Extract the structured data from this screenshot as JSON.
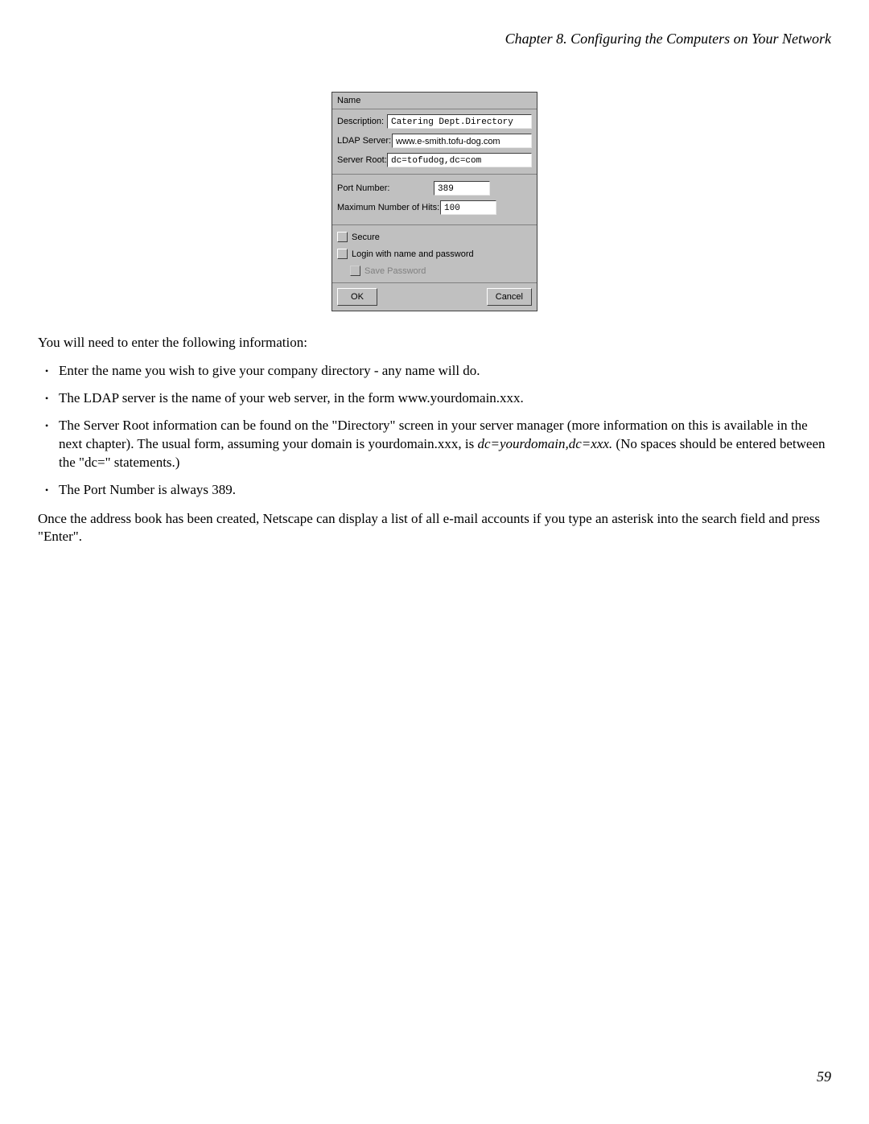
{
  "header": {
    "chapter_title": "Chapter 8. Configuring the Computers on Your Network"
  },
  "dialog": {
    "name_label": "Name",
    "description_label": "Description:",
    "description_value": "Catering Dept.Directory",
    "ldap_server_label": "LDAP Server:",
    "ldap_server_value": "www.e-smith.tofu-dog.com",
    "server_root_label": "Server Root:",
    "server_root_value": "dc=tofudog,dc=com",
    "port_number_label": "Port Number:",
    "port_number_value": "389",
    "max_hits_label": "Maximum Number of Hits:",
    "max_hits_value": "100",
    "secure_label": "Secure",
    "login_label": "Login with name and password",
    "save_password_label": "Save Password",
    "ok_label": "OK",
    "cancel_label": "Cancel"
  },
  "body": {
    "intro": "You will need to enter the following information:",
    "bullets": [
      "Enter the name you wish to give your company directory - any name will do.",
      "The LDAP server is the name of your web server, in the form www.yourdomain.xxx."
    ],
    "bullet3_part1": "The Server Root information can be found on the \"Directory\" screen in your server manager (more information on this is available in the next chapter). The usual form, assuming your domain is yourdomain.xxx, is ",
    "bullet3_italic": "dc=yourdomain,dc=xxx.",
    "bullet3_part2": " (No spaces should be entered between the \"dc=\" statements.)",
    "bullet4": "The Port Number is always 389.",
    "outro": "Once the address book has been created, Netscape can display a list of all e-mail accounts if you type an asterisk into the search field and press \"Enter\"."
  },
  "page_number": "59"
}
